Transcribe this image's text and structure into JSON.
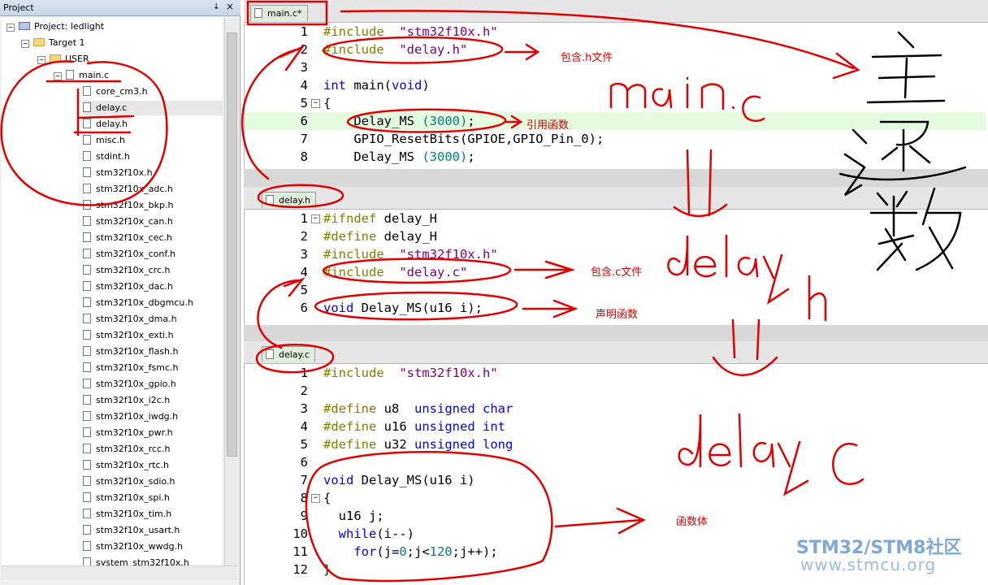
{
  "project_panel": {
    "title": "Project",
    "pin_icon": "pin-icon",
    "close_icon": "close-icon",
    "tree": [
      {
        "label": "Project: ledlight",
        "level": 0,
        "kind": "project"
      },
      {
        "label": "Target 1",
        "level": 1,
        "kind": "target"
      },
      {
        "label": "USER",
        "level": 2,
        "kind": "folder"
      },
      {
        "label": "main.c",
        "level": 3,
        "kind": "file-toggle"
      },
      {
        "label": "core_cm3.h",
        "level": 4,
        "kind": "file"
      },
      {
        "label": "delay.c",
        "level": 4,
        "kind": "file",
        "selected": true
      },
      {
        "label": "delay.h",
        "level": 4,
        "kind": "file"
      },
      {
        "label": "misc.h",
        "level": 4,
        "kind": "file"
      },
      {
        "label": "stdint.h",
        "level": 4,
        "kind": "file"
      },
      {
        "label": "stm32f10x.h",
        "level": 4,
        "kind": "file"
      },
      {
        "label": "stm32f10x_adc.h",
        "level": 4,
        "kind": "file"
      },
      {
        "label": "stm32f10x_bkp.h",
        "level": 4,
        "kind": "file"
      },
      {
        "label": "stm32f10x_can.h",
        "level": 4,
        "kind": "file"
      },
      {
        "label": "stm32f10x_cec.h",
        "level": 4,
        "kind": "file"
      },
      {
        "label": "stm32f10x_conf.h",
        "level": 4,
        "kind": "file"
      },
      {
        "label": "stm32f10x_crc.h",
        "level": 4,
        "kind": "file"
      },
      {
        "label": "stm32f10x_dac.h",
        "level": 4,
        "kind": "file"
      },
      {
        "label": "stm32f10x_dbgmcu.h",
        "level": 4,
        "kind": "file"
      },
      {
        "label": "stm32f10x_dma.h",
        "level": 4,
        "kind": "file"
      },
      {
        "label": "stm32f10x_exti.h",
        "level": 4,
        "kind": "file"
      },
      {
        "label": "stm32f10x_flash.h",
        "level": 4,
        "kind": "file"
      },
      {
        "label": "stm32f10x_fsmc.h",
        "level": 4,
        "kind": "file"
      },
      {
        "label": "stm32f10x_gpio.h",
        "level": 4,
        "kind": "file"
      },
      {
        "label": "stm32f10x_i2c.h",
        "level": 4,
        "kind": "file"
      },
      {
        "label": "stm32f10x_iwdg.h",
        "level": 4,
        "kind": "file"
      },
      {
        "label": "stm32f10x_pwr.h",
        "level": 4,
        "kind": "file"
      },
      {
        "label": "stm32f10x_rcc.h",
        "level": 4,
        "kind": "file"
      },
      {
        "label": "stm32f10x_rtc.h",
        "level": 4,
        "kind": "file"
      },
      {
        "label": "stm32f10x_sdio.h",
        "level": 4,
        "kind": "file"
      },
      {
        "label": "stm32f10x_spi.h",
        "level": 4,
        "kind": "file"
      },
      {
        "label": "stm32f10x_tim.h",
        "level": 4,
        "kind": "file"
      },
      {
        "label": "stm32f10x_usart.h",
        "level": 4,
        "kind": "file"
      },
      {
        "label": "stm32f10x_wwdg.h",
        "level": 4,
        "kind": "file"
      },
      {
        "label": "system_stm32f10x.h",
        "level": 4,
        "kind": "file"
      }
    ]
  },
  "editors": [
    {
      "tab": "main.c*",
      "lines": [
        {
          "n": "1",
          "parts": [
            [
              "pp",
              "#include "
            ],
            [
              "str",
              " \"stm32f10x.h\""
            ]
          ]
        },
        {
          "n": "2",
          "parts": [
            [
              "pp",
              "#include "
            ],
            [
              "str",
              " \"delay.h\""
            ]
          ]
        },
        {
          "n": "3",
          "parts": []
        },
        {
          "n": "4",
          "parts": [
            [
              "kw",
              "int"
            ],
            [
              "id",
              " main("
            ],
            [
              "kw",
              "void"
            ],
            [
              "id",
              ")"
            ]
          ]
        },
        {
          "n": "5",
          "fold": "-",
          "parts": [
            [
              "id",
              "{"
            ]
          ]
        },
        {
          "n": "6",
          "highlight": true,
          "parts": [
            [
              "id",
              "    Delay_MS "
            ],
            [
              "num",
              "(3000)"
            ],
            [
              "id",
              ";"
            ]
          ]
        },
        {
          "n": "7",
          "parts": [
            [
              "id",
              "    GPIO_ResetBits(GPIOE,GPIO_Pin_0);"
            ]
          ]
        },
        {
          "n": "8",
          "parts": [
            [
              "id",
              "    Delay_MS "
            ],
            [
              "num",
              "(3000)"
            ],
            [
              "id",
              ";"
            ]
          ]
        }
      ]
    },
    {
      "tab": "delay.h",
      "lines": [
        {
          "n": "1",
          "fold": "-",
          "parts": [
            [
              "pp",
              "#ifndef"
            ],
            [
              "id",
              " delay_H"
            ]
          ]
        },
        {
          "n": "2",
          "parts": [
            [
              "pp",
              "#define"
            ],
            [
              "id",
              " delay_H"
            ]
          ]
        },
        {
          "n": "3",
          "parts": [
            [
              "pp",
              "#include "
            ],
            [
              "str",
              " \"stm32f10x.h\""
            ]
          ]
        },
        {
          "n": "4",
          "parts": [
            [
              "pp",
              "#include "
            ],
            [
              "str",
              " \"delay.c\""
            ]
          ]
        },
        {
          "n": "5",
          "parts": []
        },
        {
          "n": "6",
          "parts": [
            [
              "kw",
              "void"
            ],
            [
              "id",
              " Delay_MS(u16 i);"
            ]
          ]
        }
      ]
    },
    {
      "tab": "delay.c",
      "lines": [
        {
          "n": "1",
          "parts": [
            [
              "pp",
              "#include "
            ],
            [
              "str",
              " \"stm32f10x.h\""
            ]
          ]
        },
        {
          "n": "2",
          "parts": []
        },
        {
          "n": "3",
          "parts": [
            [
              "pp",
              "#define"
            ],
            [
              "id",
              " u8  "
            ],
            [
              "kw",
              "unsigned char"
            ]
          ]
        },
        {
          "n": "4",
          "parts": [
            [
              "pp",
              "#define"
            ],
            [
              "id",
              " u16 "
            ],
            [
              "kw",
              "unsigned int"
            ]
          ]
        },
        {
          "n": "5",
          "parts": [
            [
              "pp",
              "#define"
            ],
            [
              "id",
              " u32 "
            ],
            [
              "kw",
              "unsigned long"
            ]
          ]
        },
        {
          "n": "6",
          "parts": []
        },
        {
          "n": "7",
          "parts": [
            [
              "kw",
              "void"
            ],
            [
              "id",
              " Delay_MS(u16 i)"
            ]
          ]
        },
        {
          "n": "8",
          "fold": "-",
          "parts": [
            [
              "id",
              "{"
            ]
          ]
        },
        {
          "n": "9",
          "parts": [
            [
              "id",
              "  u16 j;"
            ]
          ]
        },
        {
          "n": "10",
          "parts": [
            [
              "kw",
              "  while"
            ],
            [
              "id",
              "(i--)"
            ]
          ]
        },
        {
          "n": "11",
          "parts": [
            [
              "kw",
              "    for"
            ],
            [
              "id",
              "(j="
            ],
            [
              "num",
              "0"
            ],
            [
              "id",
              ";j<"
            ],
            [
              "num",
              "120"
            ],
            [
              "id",
              ";j++);"
            ]
          ]
        },
        {
          "n": "12",
          "parts": [
            [
              "id",
              "}"
            ]
          ]
        }
      ]
    }
  ],
  "annotations": {
    "include_h": "包含.h文件",
    "call_fn": "引用函数",
    "include_c": "包含.c文件",
    "declare_fn": "声明函数",
    "fn_body": "函数体",
    "handwritten": [
      "主函数",
      "main.c",
      "delay.h",
      "delay.c"
    ]
  },
  "watermark": {
    "line1": "STM32/STM8社区",
    "line2": "www.stmcu.org"
  },
  "colors": {
    "preprocessor": "#808000",
    "string": "#800080",
    "keyword": "#0000ff",
    "number": "#008080",
    "annotation": "#e00000",
    "tab_bg": "#dfeedb",
    "current_line": "#e4fbe0"
  }
}
